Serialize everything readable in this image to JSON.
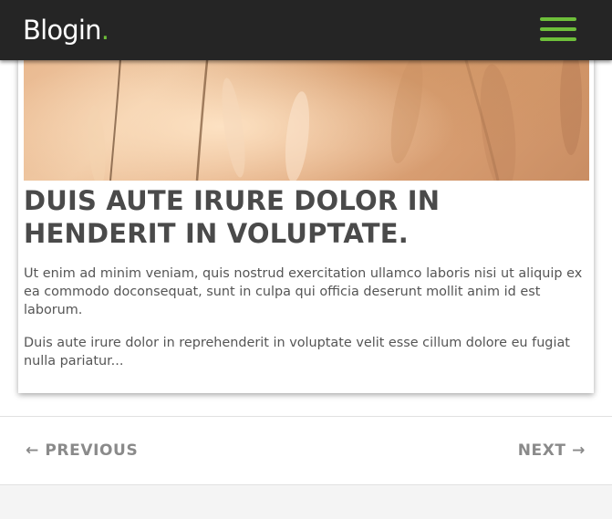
{
  "header": {
    "logo_text": "Blogin",
    "logo_dot": ".",
    "menu_icon": "hamburger-menu-icon",
    "accent_color": "#6ebf3a",
    "background_color": "#252525"
  },
  "post": {
    "image_description": "wheat field",
    "title": "DUIS AUTE IRURE DOLOR IN HENDERIT IN VOLUPTATE.",
    "paragraphs": [
      "Ut enim ad minim veniam, quis nostrud exercitation ullamco laboris nisi ut aliquip ex ea commodo doconsequat, sunt in culpa qui officia deserunt mollit anim id est laborum.",
      "Duis aute irure dolor in reprehenderit in voluptate velit esse cillum dolore eu fugiat nulla pariatur..."
    ]
  },
  "pagination": {
    "previous_label": "← PREVIOUS",
    "next_label": "NEXT →"
  }
}
